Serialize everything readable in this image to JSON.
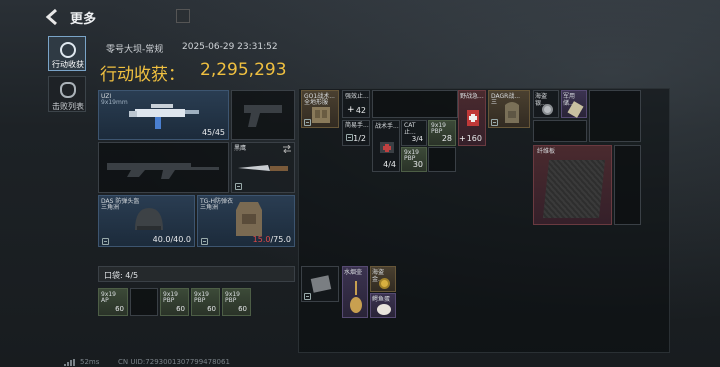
{
  "header": {
    "title": "更多"
  },
  "sidebar": {
    "tabs": [
      {
        "label": "行动收获",
        "active": true
      },
      {
        "label": "击败列表",
        "active": false
      }
    ]
  },
  "summary": {
    "map_mode": "零号大坝-常规",
    "datetime": "2025-06-29 23:31:52",
    "earnings_label": "行动收获：",
    "earnings_value": "2,295,293"
  },
  "loadout": {
    "primary": {
      "name": "UZI",
      "ammo": "9x19mm",
      "count": "45/45"
    },
    "melee": {
      "name": "黑鹰"
    },
    "helmet": {
      "name": "DAS 防弹头盔",
      "sub": "三角洲",
      "durability": "40.0/40.0"
    },
    "armor": {
      "name": "TG-H防弹衣",
      "sub": "三角洲",
      "durability_current": "15.0",
      "durability_max": "/75.0"
    }
  },
  "pocket": {
    "label": "口袋: 4/5",
    "items": [
      {
        "name": "9x19",
        "sub": "AP",
        "count": "60"
      },
      {
        "name": "",
        "sub": "",
        "count": ""
      },
      {
        "name": "9x19",
        "sub": "PBP",
        "count": "60"
      },
      {
        "name": "9x19",
        "sub": "PBP",
        "count": "60"
      },
      {
        "name": "9x19",
        "sub": "PBP",
        "count": "60"
      }
    ]
  },
  "rig": {
    "items": [
      {
        "name": "GO1战术...",
        "sub": "全地形服"
      },
      {
        "name": "强效止...",
        "count": "42"
      },
      {
        "name": "简易手...",
        "count": "1/2"
      },
      {
        "name": "战术手...",
        "count": "4/4"
      },
      {
        "name": "CAT止...",
        "count": "3/4"
      },
      {
        "name": "9x19",
        "sub": "PBP",
        "count": "28"
      },
      {
        "name": "9x19",
        "sub": "PBP",
        "count": "30"
      }
    ]
  },
  "backpack": {
    "items": [
      {
        "name": "野战急...",
        "count": "160"
      },
      {
        "name": "DAGR战...",
        "sub": "三"
      },
      {
        "name": "海盗银..."
      },
      {
        "name": "军用储..."
      },
      {
        "name": "纤维板"
      }
    ]
  },
  "bag2": {
    "items": [
      {
        "name": "水烟壶"
      },
      {
        "name": "海盗金..."
      },
      {
        "name": "鳄鱼蛋"
      }
    ]
  },
  "footer": {
    "ping": "52ms",
    "uid": "CN UID:7293001307799478061"
  },
  "colors": {
    "accent_gold": "#f0c040",
    "durability_low": "#e04848"
  }
}
